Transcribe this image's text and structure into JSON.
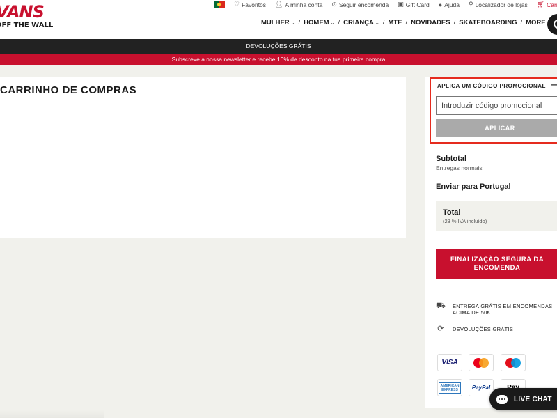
{
  "brand": {
    "logo_top": "VANS",
    "logo_bottom": "OFF THE WALL"
  },
  "utility_nav": {
    "favorites": "Favoritos",
    "account": "A minha conta",
    "track_order": "Seguir encomenda",
    "gift_card": "Gift Card",
    "help": "Ajuda",
    "store_locator": "Localizador de lojas",
    "cart": "Carrinho d"
  },
  "main_nav": {
    "women": "MULHER",
    "men": "HOMEM",
    "kids": "CRIANÇA",
    "mte": "MTE",
    "new": "NOVIDADES",
    "skateboarding": "SKATEBOARDING",
    "more": "MORE"
  },
  "banners": {
    "returns": "DEVOLUÇÕES GRÁTIS",
    "newsletter": "Subscreve a nossa newsletter e recebe 10% de desconto na tua primeira compra"
  },
  "cart": {
    "title": "CARRINHO DE COMPRAS"
  },
  "summary": {
    "promo": {
      "title": "APLICA UM CÓDIGO PROMOCIONAL",
      "collapse": "—",
      "placeholder": "Introduzir código promocional",
      "value": "",
      "apply": "APLICAR"
    },
    "subtotal_label": "Subtotal",
    "shipping_type": "Entregas normais",
    "ship_to": "Enviar para Portugal",
    "total_label": "Total",
    "vat_note": "(23 % IVA incluído)",
    "checkout": "FINALIZAÇÃO SEGURA DA ENCOMENDA",
    "features": {
      "free_shipping": "ENTREGA GRÁTIS EM ENCOMENDAS ACIMA DE 50€",
      "free_returns": "DEVOLUÇÕES GRÁTIS"
    },
    "payments": {
      "visa": "VISA",
      "mastercard": "",
      "maestro": "",
      "amex_line1": "AMERICAN",
      "amex_line2": "EXPRESS",
      "paypal": "PayPal",
      "applepay": " Pay"
    }
  },
  "live_chat": {
    "label": "LIVE CHAT"
  },
  "colors": {
    "brand_red": "#c8102e",
    "dark": "#1a1a1a",
    "highlight": "#e52b1e"
  },
  "icons": {
    "favorites": "heart-icon",
    "account": "user-icon",
    "track": "tracking-icon",
    "gift": "gift-card-icon",
    "help": "help-icon",
    "locator": "location-pin-icon",
    "cart": "cart-icon",
    "search": "search-icon"
  }
}
